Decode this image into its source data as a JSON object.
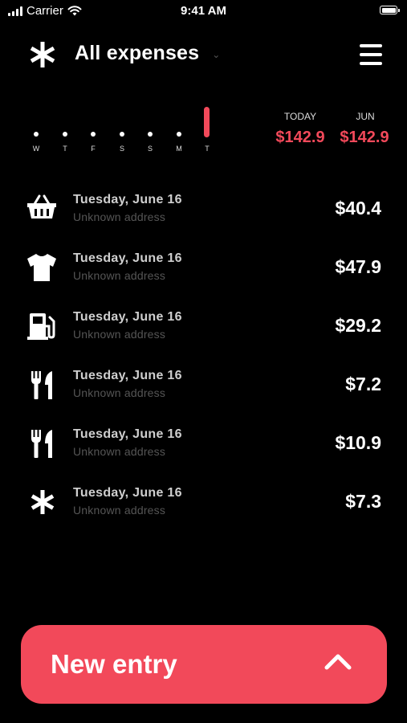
{
  "status_bar": {
    "carrier": "Carrier",
    "time": "9:41 AM"
  },
  "header": {
    "title": "All expenses",
    "chevron": "⌄",
    "logo_icon": "asterisk-icon",
    "menu_icon": "hamburger-menu-icon"
  },
  "week": {
    "days": [
      "W",
      "T",
      "F",
      "S",
      "S",
      "M",
      "T"
    ],
    "selected_index": 6
  },
  "summary": {
    "today_label": "TODAY",
    "today_value": "$142.9",
    "month_label": "JUN",
    "month_value": "$142.9"
  },
  "expenses": [
    {
      "icon": "basket-icon",
      "date": "Tuesday, June 16",
      "address": "Unknown address",
      "amount": "$40.4"
    },
    {
      "icon": "tshirt-icon",
      "date": "Tuesday, June 16",
      "address": "Unknown address",
      "amount": "$47.9"
    },
    {
      "icon": "fuel-pump-icon",
      "date": "Tuesday, June 16",
      "address": "Unknown address",
      "amount": "$29.2"
    },
    {
      "icon": "fork-knife-icon",
      "date": "Tuesday, June 16",
      "address": "Unknown address",
      "amount": "$7.2"
    },
    {
      "icon": "fork-knife-icon",
      "date": "Tuesday, June 16",
      "address": "Unknown address",
      "amount": "$10.9"
    },
    {
      "icon": "asterisk-icon",
      "date": "Tuesday, June 16",
      "address": "Unknown address",
      "amount": "$7.3"
    }
  ],
  "new_entry": {
    "label": "New entry",
    "icon": "chevron-up-icon"
  },
  "colors": {
    "accent": "#f2495a",
    "background": "#000000",
    "muted_text": "#555555"
  }
}
